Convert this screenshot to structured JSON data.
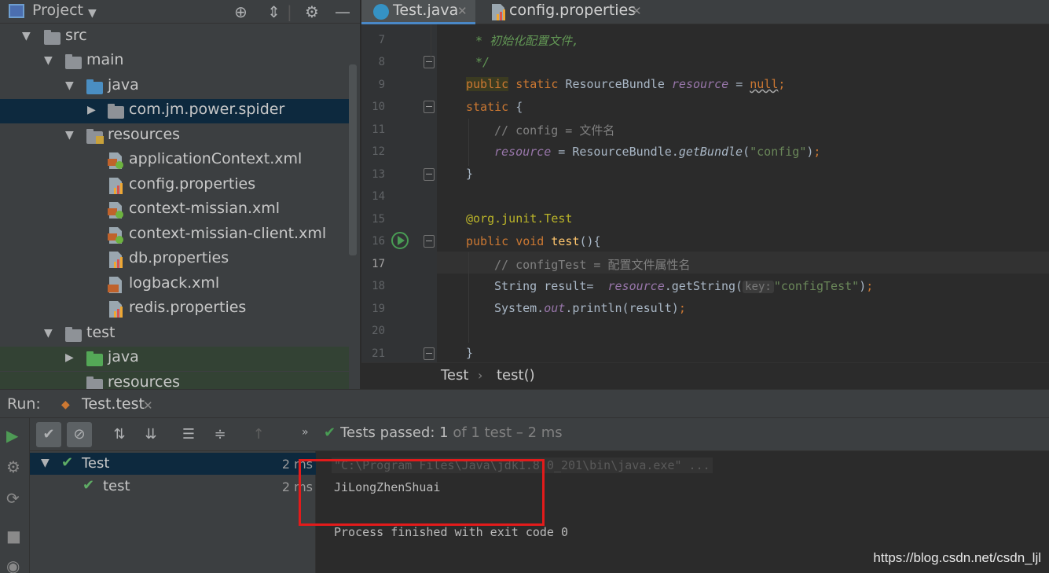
{
  "project_panel": {
    "title": "Project",
    "tree": [
      {
        "label": "src",
        "type": "folder-gray",
        "depth": 0,
        "expanded": true
      },
      {
        "label": "main",
        "type": "folder-gray",
        "depth": 1,
        "expanded": true
      },
      {
        "label": "java",
        "type": "folder-blue",
        "depth": 2,
        "expanded": true
      },
      {
        "label": "com.jm.power.spider",
        "type": "package",
        "depth": 3,
        "expanded": false,
        "selected": true
      },
      {
        "label": "resources",
        "type": "folder-resources",
        "depth": 2,
        "expanded": true
      },
      {
        "label": "applicationContext.xml",
        "type": "spring-xml",
        "depth": 3
      },
      {
        "label": "config.properties",
        "type": "properties",
        "depth": 3
      },
      {
        "label": "context-missian.xml",
        "type": "spring-xml",
        "depth": 3
      },
      {
        "label": "context-missian-client.xml",
        "type": "spring-xml",
        "depth": 3
      },
      {
        "label": "db.properties",
        "type": "properties",
        "depth": 3
      },
      {
        "label": "logback.xml",
        "type": "xml",
        "depth": 3
      },
      {
        "label": "redis.properties",
        "type": "properties",
        "depth": 3
      },
      {
        "label": "test",
        "type": "folder-gray",
        "depth": 1,
        "expanded": true
      },
      {
        "label": "java",
        "type": "folder-green",
        "depth": 2,
        "expanded": false
      },
      {
        "label": "resources",
        "type": "folder-resources",
        "depth": 2
      }
    ]
  },
  "editor": {
    "tabs": [
      {
        "label": "Test.java",
        "active": true
      },
      {
        "label": "config.properties",
        "active": false
      }
    ],
    "line_numbers": [
      "7",
      "8",
      "9",
      "10",
      "11",
      "12",
      "13",
      "14",
      "15",
      "16",
      "17",
      "18",
      "19",
      "20",
      "21"
    ],
    "current_line": "17",
    "code": {
      "l7": "* 初始化配置文件,",
      "l8": "*/",
      "l9_kw1": "public",
      "l9_kw2": "static",
      "l9_type": "ResourceBundle",
      "l9_field": "resource",
      "l9_eq": "=",
      "l9_null": "null",
      "l10_kw": "static",
      "l10_brace": "{",
      "l11": "// config = 文件名",
      "l12_field": "resource",
      "l12_eq": "= ResourceBundle.",
      "l12_method": "getBundle",
      "l12_open": "(",
      "l12_str": "\"config\"",
      "l12_close": ")",
      "l13": "}",
      "l15_at": "@org.junit.",
      "l15_ann": "Test",
      "l16_kw": "public void",
      "l16_fn": "test",
      "l16_rest": "(){",
      "l17": "// configTest = 配置文件属性名",
      "l18_a": "String result=",
      "l18_field": "resource",
      "l18_b": ".getString(",
      "l18_hint": "key:",
      "l18_str": "\"configTest\"",
      "l18_c": ")",
      "l19_a": "System.",
      "l19_out": "out",
      "l19_b": ".println(result)",
      "l21": "}"
    },
    "breadcrumbs": [
      "Test",
      "test()"
    ]
  },
  "run_panel": {
    "label": "Run:",
    "tab_label": "Test.test",
    "status_prefix": "Tests passed:",
    "status_count": "1",
    "status_suffix": "of 1 test – 2 ms",
    "tree": [
      {
        "label": "Test",
        "time": "2 ms",
        "expanded": true
      },
      {
        "label": "test",
        "time": "2 ms"
      }
    ],
    "console": {
      "command": "\"C:\\Program Files\\Java\\jdk1.8.0_201\\bin\\java.exe\" ...",
      "output": "JiLongZhenShuai",
      "exit": "Process finished with exit code 0"
    }
  },
  "watermark": "https://blog.csdn.net/csdn_ljl",
  "colors": {
    "background": "#2b2b2b",
    "panel": "#3c3f41",
    "selection": "#0d293e",
    "keyword": "#cc7832",
    "field": "#9876aa",
    "string": "#6a8759",
    "pass_green": "#499c54",
    "highlight_box": "#e21b1b"
  }
}
